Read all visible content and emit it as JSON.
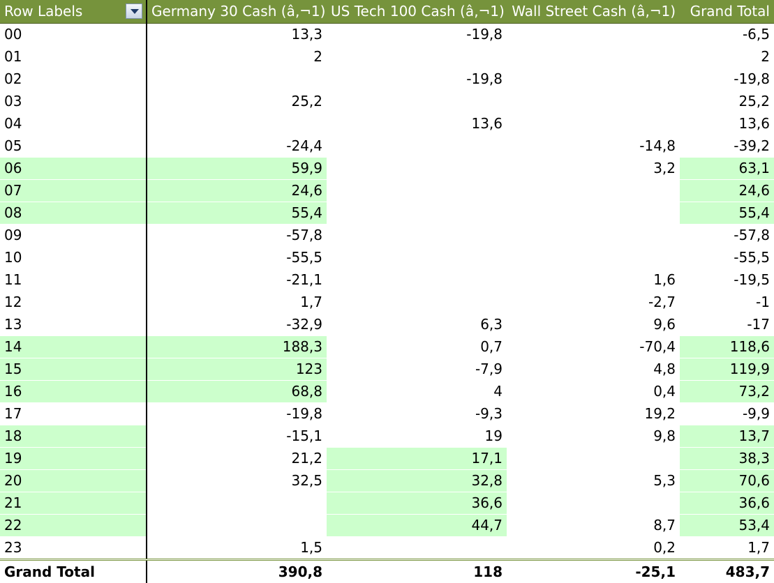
{
  "headers": {
    "row_labels": "Row Labels",
    "col1": "Germany 30 Cash (â‚¬1)",
    "col2": "US Tech 100 Cash (â‚¬1)",
    "col3": "Wall Street Cash (â‚¬1)",
    "grand_total": "Grand Total"
  },
  "highlight_color": "#ccffcc",
  "header_color": "#76933c",
  "rows": [
    {
      "label": "00",
      "g30": "13,3",
      "us100": "-19,8",
      "ws": "",
      "total": "-6,5",
      "hl": []
    },
    {
      "label": "01",
      "g30": "2",
      "us100": "",
      "ws": "",
      "total": "2",
      "hl": []
    },
    {
      "label": "02",
      "g30": "",
      "us100": "-19,8",
      "ws": "",
      "total": "-19,8",
      "hl": []
    },
    {
      "label": "03",
      "g30": "25,2",
      "us100": "",
      "ws": "",
      "total": "25,2",
      "hl": []
    },
    {
      "label": "04",
      "g30": "",
      "us100": "13,6",
      "ws": "",
      "total": "13,6",
      "hl": []
    },
    {
      "label": "05",
      "g30": "-24,4",
      "us100": "",
      "ws": "-14,8",
      "total": "-39,2",
      "hl": []
    },
    {
      "label": "06",
      "g30": "59,9",
      "us100": "",
      "ws": "3,2",
      "total": "63,1",
      "hl": [
        "label",
        "g30",
        "total"
      ]
    },
    {
      "label": "07",
      "g30": "24,6",
      "us100": "",
      "ws": "",
      "total": "24,6",
      "hl": [
        "label",
        "g30",
        "total"
      ]
    },
    {
      "label": "08",
      "g30": "55,4",
      "us100": "",
      "ws": "",
      "total": "55,4",
      "hl": [
        "label",
        "g30",
        "total"
      ]
    },
    {
      "label": "09",
      "g30": "-57,8",
      "us100": "",
      "ws": "",
      "total": "-57,8",
      "hl": []
    },
    {
      "label": "10",
      "g30": "-55,5",
      "us100": "",
      "ws": "",
      "total": "-55,5",
      "hl": []
    },
    {
      "label": "11",
      "g30": "-21,1",
      "us100": "",
      "ws": "1,6",
      "total": "-19,5",
      "hl": []
    },
    {
      "label": "12",
      "g30": "1,7",
      "us100": "",
      "ws": "-2,7",
      "total": "-1",
      "hl": []
    },
    {
      "label": "13",
      "g30": "-32,9",
      "us100": "6,3",
      "ws": "9,6",
      "total": "-17",
      "hl": []
    },
    {
      "label": "14",
      "g30": "188,3",
      "us100": "0,7",
      "ws": "-70,4",
      "total": "118,6",
      "hl": [
        "label",
        "g30",
        "total"
      ]
    },
    {
      "label": "15",
      "g30": "123",
      "us100": "-7,9",
      "ws": "4,8",
      "total": "119,9",
      "hl": [
        "label",
        "g30",
        "total"
      ]
    },
    {
      "label": "16",
      "g30": "68,8",
      "us100": "4",
      "ws": "0,4",
      "total": "73,2",
      "hl": [
        "label",
        "g30",
        "total"
      ]
    },
    {
      "label": "17",
      "g30": "-19,8",
      "us100": "-9,3",
      "ws": "19,2",
      "total": "-9,9",
      "hl": []
    },
    {
      "label": "18",
      "g30": "-15,1",
      "us100": "19",
      "ws": "9,8",
      "total": "13,7",
      "hl": [
        "label",
        "total"
      ]
    },
    {
      "label": "19",
      "g30": "21,2",
      "us100": "17,1",
      "ws": "",
      "total": "38,3",
      "hl": [
        "label",
        "us100",
        "total"
      ]
    },
    {
      "label": "20",
      "g30": "32,5",
      "us100": "32,8",
      "ws": "5,3",
      "total": "70,6",
      "hl": [
        "label",
        "us100",
        "total"
      ]
    },
    {
      "label": "21",
      "g30": "",
      "us100": "36,6",
      "ws": "",
      "total": "36,6",
      "hl": [
        "label",
        "us100",
        "total"
      ]
    },
    {
      "label": "22",
      "g30": "",
      "us100": "44,7",
      "ws": "8,7",
      "total": "53,4",
      "hl": [
        "label",
        "us100",
        "total"
      ]
    },
    {
      "label": "23",
      "g30": "1,5",
      "us100": "",
      "ws": "0,2",
      "total": "1,7",
      "hl": []
    }
  ],
  "footer": {
    "label": "Grand Total",
    "g30": "390,8",
    "us100": "118",
    "ws": "-25,1",
    "total": "483,7"
  }
}
